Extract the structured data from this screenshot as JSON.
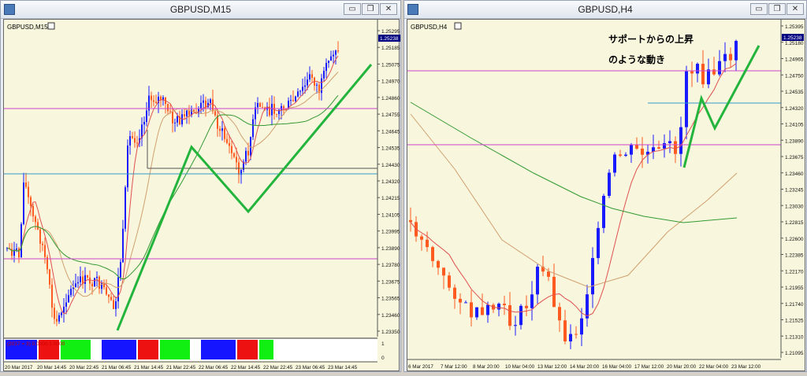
{
  "left_window": {
    "title": "GBPUSD,M15",
    "inner_label": "GBPUSD,M15",
    "buttons": {
      "minimize": "▭",
      "restore": "❐",
      "close": "✕"
    },
    "price_axis": [
      "1.25295",
      "1.25185",
      "1.25075",
      "1.24970",
      "1.24860",
      "1.24755",
      "1.24645",
      "1.24535",
      "1.24430",
      "1.24320",
      "1.24215",
      "1.24105",
      "1.23995",
      "1.23890",
      "1.23780",
      "1.23675",
      "1.23565",
      "1.23460",
      "1.23350"
    ],
    "current_price": "1.25238",
    "time_axis": [
      "20 Mar 2017",
      "20 Mar 14:45",
      "20 Mar 22:45",
      "21 Mar 06:45",
      "21 Mar 14:45",
      "21 Mar 22:45",
      "22 Mar 06:45",
      "22 Mar 14:45",
      "22 Mar 22:45",
      "23 Mar 06:45",
      "23 Mar 14:45"
    ],
    "indicator_label": "(2017 = 3) 0.0000 1.0000",
    "indicator_axis": [
      "1",
      "0"
    ],
    "indicator_colors": [
      "#1515ff",
      "#ee1111",
      "#11ee11",
      "#ffffff",
      "#1515ff",
      "#ee1111",
      "#11ee11",
      "#ffffff",
      "#1515ff",
      "#ee1111",
      "#11ee11"
    ]
  },
  "right_window": {
    "title": "GBPUSD,H4",
    "inner_label": "GBPUSD,H4",
    "buttons": {
      "minimize": "▭",
      "restore": "❐",
      "close": "✕"
    },
    "annotation_line1": "サポートからの上昇",
    "annotation_line2": "のような動き",
    "price_axis": [
      "1.25395",
      "1.25180",
      "1.24965",
      "1.24750",
      "1.24535",
      "1.24320",
      "1.24105",
      "1.23890",
      "1.23675",
      "1.23460",
      "1.23245",
      "1.23030",
      "1.22815",
      "1.22600",
      "1.22385",
      "1.22170",
      "1.21955",
      "1.21740",
      "1.21525",
      "1.21310",
      "1.21095"
    ],
    "current_price": "1.25238",
    "time_axis": [
      "6 Mar 2017",
      "7 Mar 12:00",
      "8 Mar 20:00",
      "10 Mar 04:00",
      "13 Mar 12:00",
      "14 Mar 20:00",
      "16 Mar 04:00",
      "17 Mar 12:00",
      "20 Mar 20:00",
      "22 Mar 04:00",
      "23 Mar 12:00"
    ]
  },
  "colors": {
    "plot_bg": "#f8f6dc",
    "bull": "#1a1aff",
    "bear": "#ff5a1f",
    "magenta_line": "#cc44cc",
    "blue_line": "#3399cc",
    "green_drawing": "#22b43c",
    "ma_red": "#e05050",
    "ma_tan": "#d0a070",
    "ma_green": "#339933"
  }
}
